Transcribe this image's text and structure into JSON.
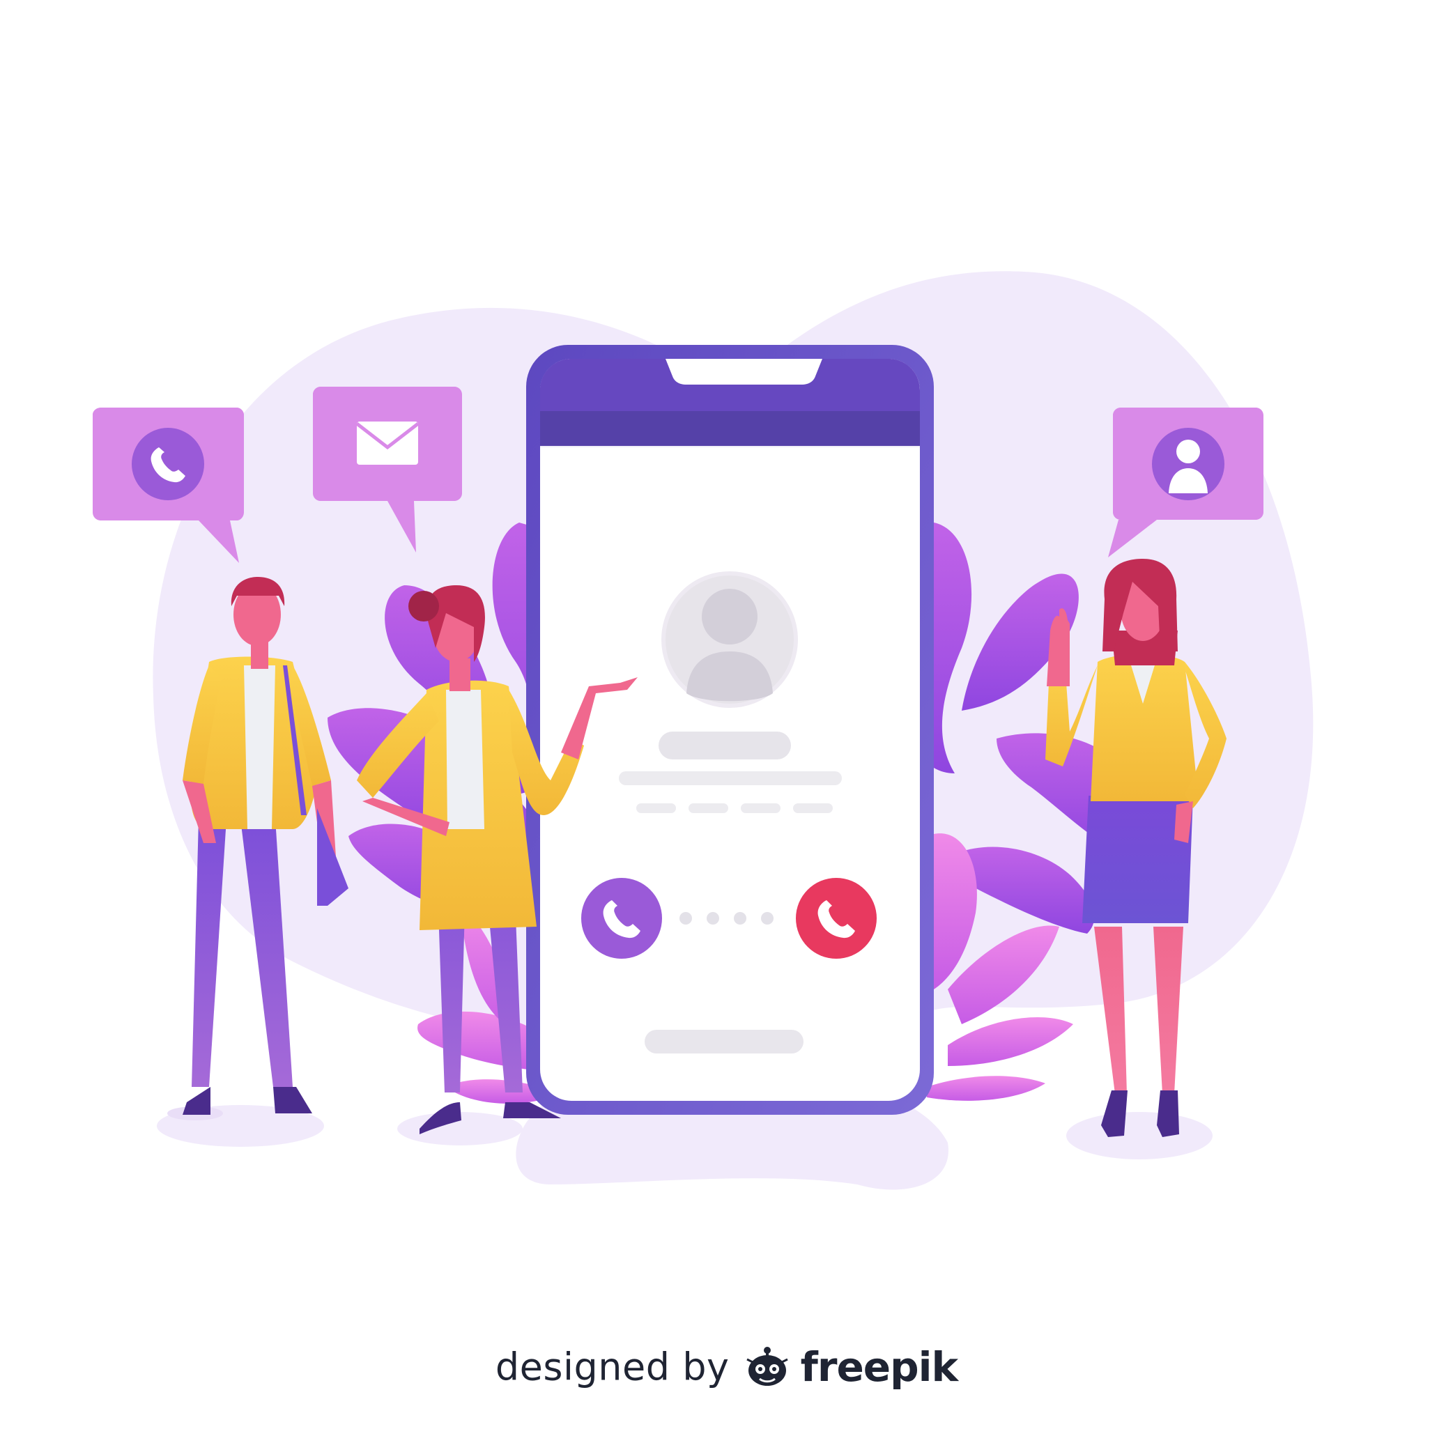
{
  "credit": {
    "prefix": "designed by",
    "brand": "freepik"
  },
  "icons": {
    "bubble_left": "phone-icon",
    "bubble_middle": "envelope-icon",
    "bubble_right": "user-icon",
    "accept": "phone-icon",
    "decline": "phone-icon"
  },
  "colors": {
    "accent_purple": "#9b5de5",
    "accept_button": "#9a5ad8",
    "decline_button": "#e8395f",
    "bubble": "#d98ae8",
    "phone_frame": "#6a55c8",
    "jacket": "#f7c343",
    "background_blob": "#f1eafb"
  }
}
